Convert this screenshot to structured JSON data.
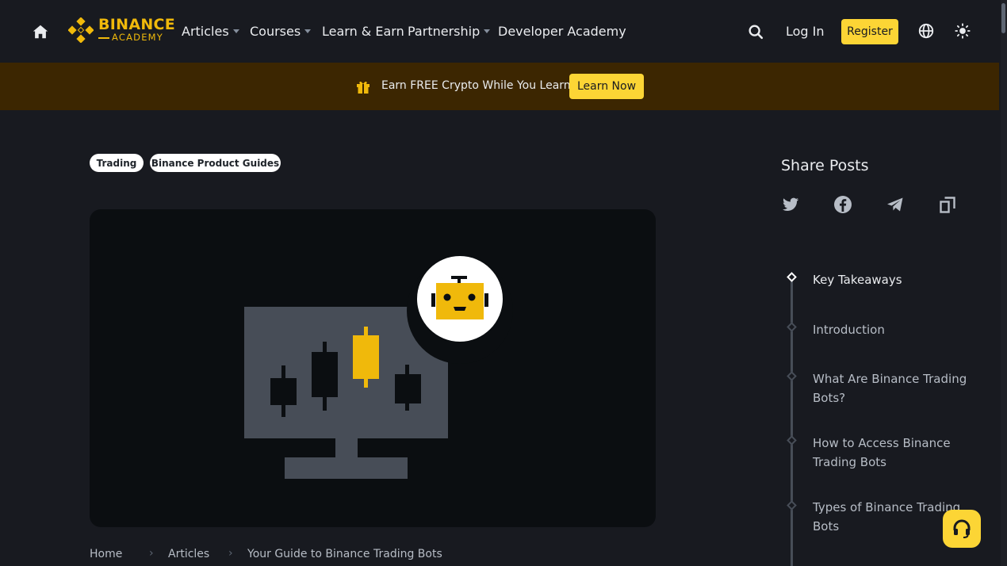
{
  "header": {
    "logo_top": "BINANCE",
    "logo_bottom": "ACADEMY",
    "nav": [
      {
        "label": "Articles",
        "dropdown": true
      },
      {
        "label": "Courses",
        "dropdown": true
      },
      {
        "label": "Learn & Earn",
        "dropdown": false
      },
      {
        "label": "Partnership",
        "dropdown": true
      },
      {
        "label": "Developer Academy",
        "dropdown": false
      }
    ],
    "login_label": "Log In",
    "register_label": "Register"
  },
  "banner": {
    "text": "Earn FREE Crypto While You Learn",
    "button_label": "Learn Now"
  },
  "tags": [
    "Trading",
    "Binance Product Guides"
  ],
  "breadcrumb": [
    "Home",
    "Articles",
    "Your Guide to Binance Trading Bots"
  ],
  "sidebar": {
    "share_title": "Share Posts",
    "share_icons": [
      "twitter-icon",
      "facebook-icon",
      "telegram-icon",
      "copy-link-icon"
    ],
    "toc": [
      {
        "label": "Key Takeaways",
        "active": true
      },
      {
        "label": "Introduction",
        "active": false
      },
      {
        "label": "What Are Binance Trading Bots?",
        "active": false
      },
      {
        "label": "How to Access Binance Trading Bots",
        "active": false
      },
      {
        "label": "Types of Binance Trading Bots",
        "active": false
      }
    ]
  },
  "colors": {
    "brand_yellow": "#fcd535",
    "logo_yellow": "#f0b90b",
    "background": "#181a20",
    "banner_bg": "#3c2601"
  }
}
